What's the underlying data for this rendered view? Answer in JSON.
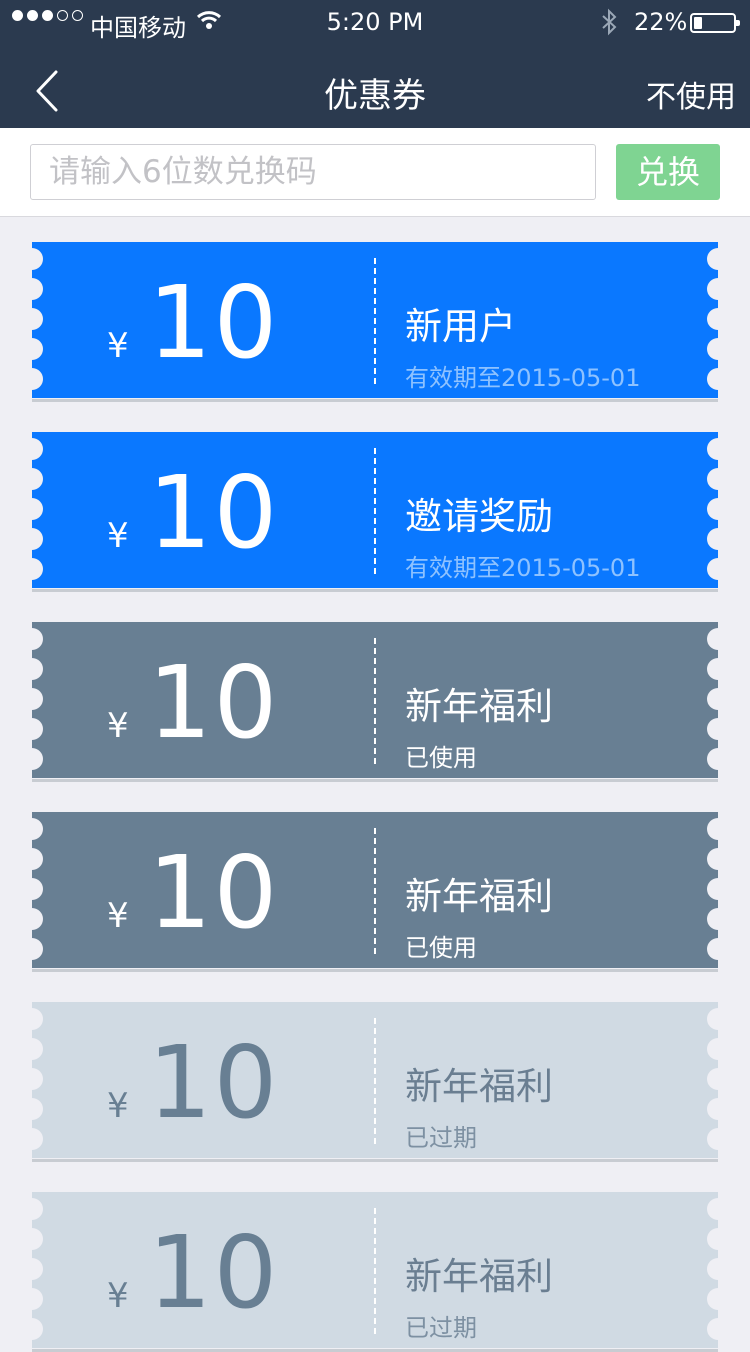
{
  "status_bar": {
    "carrier": "中国移动",
    "time": "5:20 PM",
    "battery": "22%",
    "battery_level": 0.22,
    "signal_bars_filled": 3,
    "signal_bars_total": 5,
    "icons": [
      "wifi-icon",
      "bluetooth-icon",
      "battery-icon"
    ]
  },
  "nav": {
    "title": "优惠券",
    "right_action": "不使用",
    "back_icon": "chevron-left-icon"
  },
  "redeem": {
    "placeholder": "请输入6位数兑换码",
    "value": "",
    "button": "兑换"
  },
  "colors": {
    "header_bg": "#2b3a4f",
    "active_coupon": "#0a78ff",
    "used_coupon": "#687f93",
    "expired_coupon": "#d0dae3",
    "redeem_button": "#7fd492",
    "page_bg": "#efeff4"
  },
  "coupons": [
    {
      "currency": "¥",
      "amount": "10",
      "name": "新用户",
      "sub": "有效期至2015-05-01",
      "state": "active"
    },
    {
      "currency": "¥",
      "amount": "10",
      "name": "邀请奖励",
      "sub": "有效期至2015-05-01",
      "state": "active"
    },
    {
      "currency": "¥",
      "amount": "10",
      "name": "新年福利",
      "sub": "已使用",
      "state": "used"
    },
    {
      "currency": "¥",
      "amount": "10",
      "name": "新年福利",
      "sub": "已使用",
      "state": "used"
    },
    {
      "currency": "¥",
      "amount": "10",
      "name": "新年福利",
      "sub": "已过期",
      "state": "expired"
    },
    {
      "currency": "¥",
      "amount": "10",
      "name": "新年福利",
      "sub": "已过期",
      "state": "expired"
    }
  ]
}
